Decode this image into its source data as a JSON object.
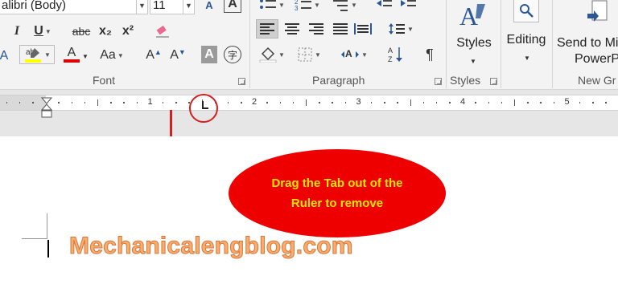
{
  "ribbon": {
    "font_group": {
      "font_name": "alibri (Body)",
      "font_size": "11",
      "label": "Font",
      "grow_font": "A",
      "shrink_font": "A",
      "text_effects": "A",
      "underline": "U",
      "strikethrough": "abc",
      "subscript": "x₂",
      "superscript": "x²",
      "font_color": "A",
      "change_case": "Aa",
      "grow_font_small": "A",
      "shrink_font_small": "A",
      "char_shading": "A",
      "enclose_char": "字"
    },
    "paragraph_group": {
      "label": "Paragraph"
    },
    "styles_group": {
      "button_label": "Styles",
      "label": "Styles"
    },
    "editing_group": {
      "button_label": "Editing"
    },
    "new_group": {
      "button_label_line1": "Send to Mi",
      "button_label_line2": "PowerP",
      "label": "New Gr"
    }
  },
  "ruler": {
    "numbers": [
      "1",
      "2",
      "3",
      "4",
      "5"
    ]
  },
  "annotation": {
    "callout_text": "Drag the Tab out of the Ruler to remove",
    "watermark": "Mechanicalengblog.com"
  },
  "colors": {
    "callout_fill": "#ee0000",
    "callout_text": "#ffe600",
    "arrow": "#d42020",
    "watermark": "#f6ad6d"
  }
}
